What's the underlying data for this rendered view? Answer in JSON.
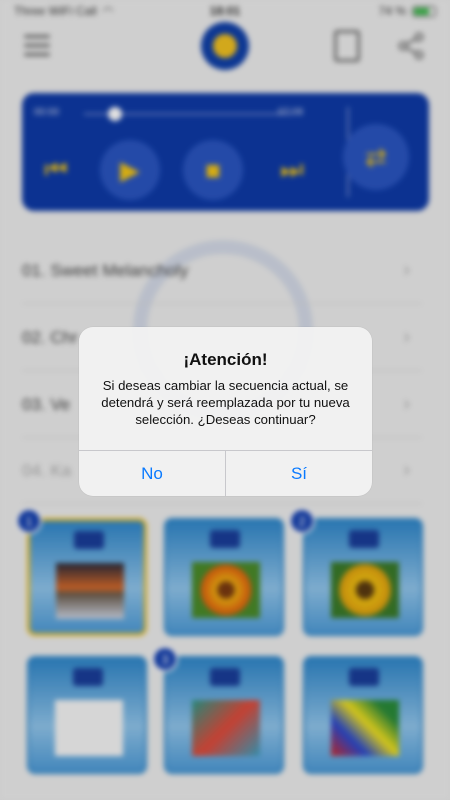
{
  "status_bar": {
    "carrier": "Three WiFi Call",
    "time": "18:01",
    "battery": "74 %"
  },
  "player": {
    "elapsed": "00:00",
    "duration": "07:08",
    "progress": 0.1
  },
  "tracks": [
    {
      "label": "01. Sweet Melancholy"
    },
    {
      "label": "02. Chr"
    },
    {
      "label": "03. Ve"
    },
    {
      "label": "04. Ka"
    }
  ],
  "badges": {
    "first": "1",
    "second": "2",
    "third": "3"
  },
  "dialog": {
    "title": "¡Atención!",
    "message": "Si deseas cambiar la secuencia actual, se detendrá y será reemplazada por tu nueva selección. ¿Deseas continuar?",
    "buttons": {
      "no": "No",
      "yes": "Sí"
    }
  },
  "colors": {
    "player_bg": "#0e3aa6",
    "accent": "#f2c416",
    "ios_blue": "#0a7aff"
  }
}
